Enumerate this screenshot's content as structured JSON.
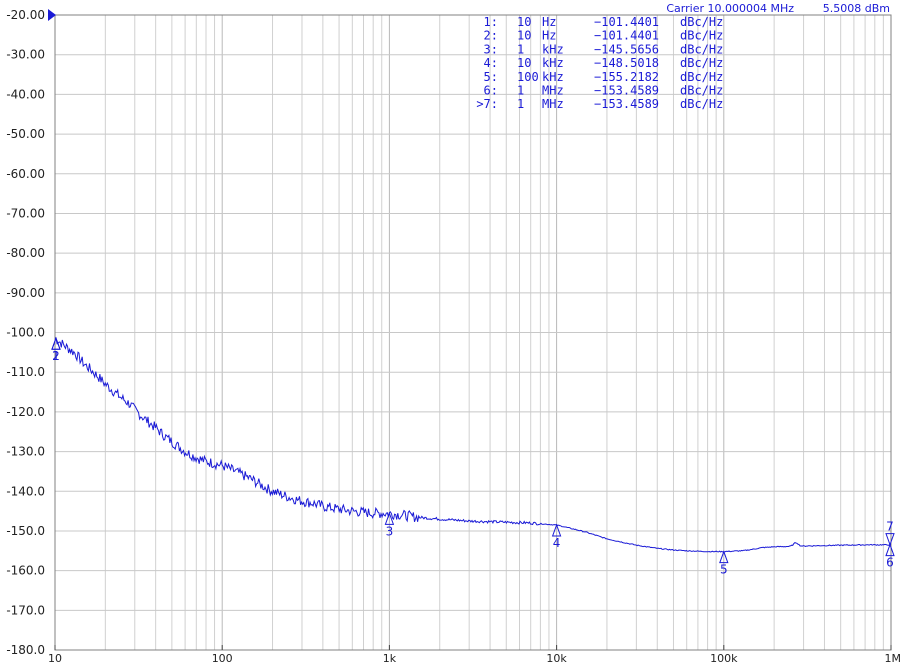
{
  "header": {
    "carrier_label": "Carrier 10.000004 MHz",
    "power_label": "5.5008 dBm"
  },
  "marker_table": [
    {
      "sel": " ",
      "idx": "1:",
      "freq": "10",
      "unit": "Hz",
      "value": "−101.4401",
      "vunit": "dBc/Hz"
    },
    {
      "sel": " ",
      "idx": "2:",
      "freq": "10",
      "unit": "Hz",
      "value": "−101.4401",
      "vunit": "dBc/Hz"
    },
    {
      "sel": " ",
      "idx": "3:",
      "freq": "1",
      "unit": "kHz",
      "value": "−145.5656",
      "vunit": "dBc/Hz"
    },
    {
      "sel": " ",
      "idx": "4:",
      "freq": "10",
      "unit": "kHz",
      "value": "−148.5018",
      "vunit": "dBc/Hz"
    },
    {
      "sel": " ",
      "idx": "5:",
      "freq": "100",
      "unit": "kHz",
      "value": "−155.2182",
      "vunit": "dBc/Hz"
    },
    {
      "sel": " ",
      "idx": "6:",
      "freq": "1",
      "unit": "MHz",
      "value": "−153.4589",
      "vunit": "dBc/Hz"
    },
    {
      "sel": ">",
      "idx": "7:",
      "freq": "1",
      "unit": "MHz",
      "value": "−153.4589",
      "vunit": "dBc/Hz"
    }
  ],
  "chart_data": {
    "type": "line",
    "xscale": "log",
    "xlim": [
      10,
      1000000
    ],
    "ylim": [
      -180,
      -20
    ],
    "grid": true,
    "title": "",
    "xlabel": "",
    "ylabel": "",
    "y_ticks": [
      {
        "value": -20,
        "label": "-20.00"
      },
      {
        "value": -30,
        "label": "-30.00"
      },
      {
        "value": -40,
        "label": "-40.00"
      },
      {
        "value": -50,
        "label": "-50.00"
      },
      {
        "value": -60,
        "label": "-60.00"
      },
      {
        "value": -70,
        "label": "-70.00"
      },
      {
        "value": -80,
        "label": "-80.00"
      },
      {
        "value": -90,
        "label": "-90.00"
      },
      {
        "value": -100,
        "label": "-100.0"
      },
      {
        "value": -110,
        "label": "-110.0"
      },
      {
        "value": -120,
        "label": "-120.0"
      },
      {
        "value": -130,
        "label": "-130.0"
      },
      {
        "value": -140,
        "label": "-140.0"
      },
      {
        "value": -150,
        "label": "-150.0"
      },
      {
        "value": -160,
        "label": "-160.0"
      },
      {
        "value": -170,
        "label": "-170.0"
      },
      {
        "value": -180,
        "label": "-180.0"
      }
    ],
    "x_ticks": [
      {
        "value": 10,
        "label": "10"
      },
      {
        "value": 100,
        "label": "100"
      },
      {
        "value": 1000,
        "label": "1k"
      },
      {
        "value": 10000,
        "label": "10k"
      },
      {
        "value": 100000,
        "label": "100k"
      },
      {
        "value": 1000000,
        "label": "1M"
      }
    ],
    "series": [
      {
        "color": "#1a1ad6",
        "x": [
          10,
          11,
          12,
          13,
          14,
          15,
          16,
          18,
          20,
          22,
          25,
          28,
          30,
          35,
          40,
          45,
          50,
          60,
          70,
          80,
          90,
          100,
          120,
          150,
          180,
          200,
          250,
          300,
          350,
          400,
          500,
          600,
          700,
          800,
          1000,
          1200,
          1500,
          2000,
          3000,
          5000,
          7000,
          10000,
          12000,
          15000,
          20000,
          30000,
          40000,
          50000,
          60000,
          80000,
          100000,
          130000,
          150000,
          170000,
          200000,
          300000,
          500000,
          700000,
          1000000
        ],
        "y": [
          -101.4,
          -102.8,
          -104.0,
          -105.0,
          -106.5,
          -108.0,
          -109.0,
          -111.0,
          -113.0,
          -114.5,
          -116.5,
          -118.0,
          -119.5,
          -122.0,
          -124.0,
          -126.0,
          -127.5,
          -130.0,
          -131.5,
          -132.5,
          -133.0,
          -133.5,
          -135.0,
          -137.0,
          -139.0,
          -140.0,
          -141.5,
          -142.5,
          -143.0,
          -143.8,
          -144.5,
          -145.0,
          -145.3,
          -145.5,
          -145.6,
          -146.0,
          -146.6,
          -147.0,
          -147.5,
          -147.8,
          -148.0,
          -148.5,
          -149.3,
          -150.3,
          -152.0,
          -153.6,
          -154.4,
          -154.8,
          -155.0,
          -155.2,
          -155.2,
          -155.0,
          -154.6,
          -154.2,
          -154.0,
          -153.8,
          -153.6,
          -153.5,
          -153.5
        ]
      }
    ],
    "markers": [
      {
        "label": "1",
        "freq": 10,
        "value": -101.4401,
        "dir": "up"
      },
      {
        "label": "2",
        "freq": 10,
        "value": -101.4401,
        "dir": "up"
      },
      {
        "label": "3",
        "freq": 1000,
        "value": -145.5656,
        "dir": "up"
      },
      {
        "label": "4",
        "freq": 10000,
        "value": -148.5018,
        "dir": "up"
      },
      {
        "label": "5",
        "freq": 100000,
        "value": -155.2182,
        "dir": "up"
      },
      {
        "label": "6",
        "freq": 1000000,
        "value": -153.4589,
        "dir": "up"
      },
      {
        "label": "7",
        "freq": 1000000,
        "value": -153.4589,
        "dir": "down"
      }
    ]
  }
}
